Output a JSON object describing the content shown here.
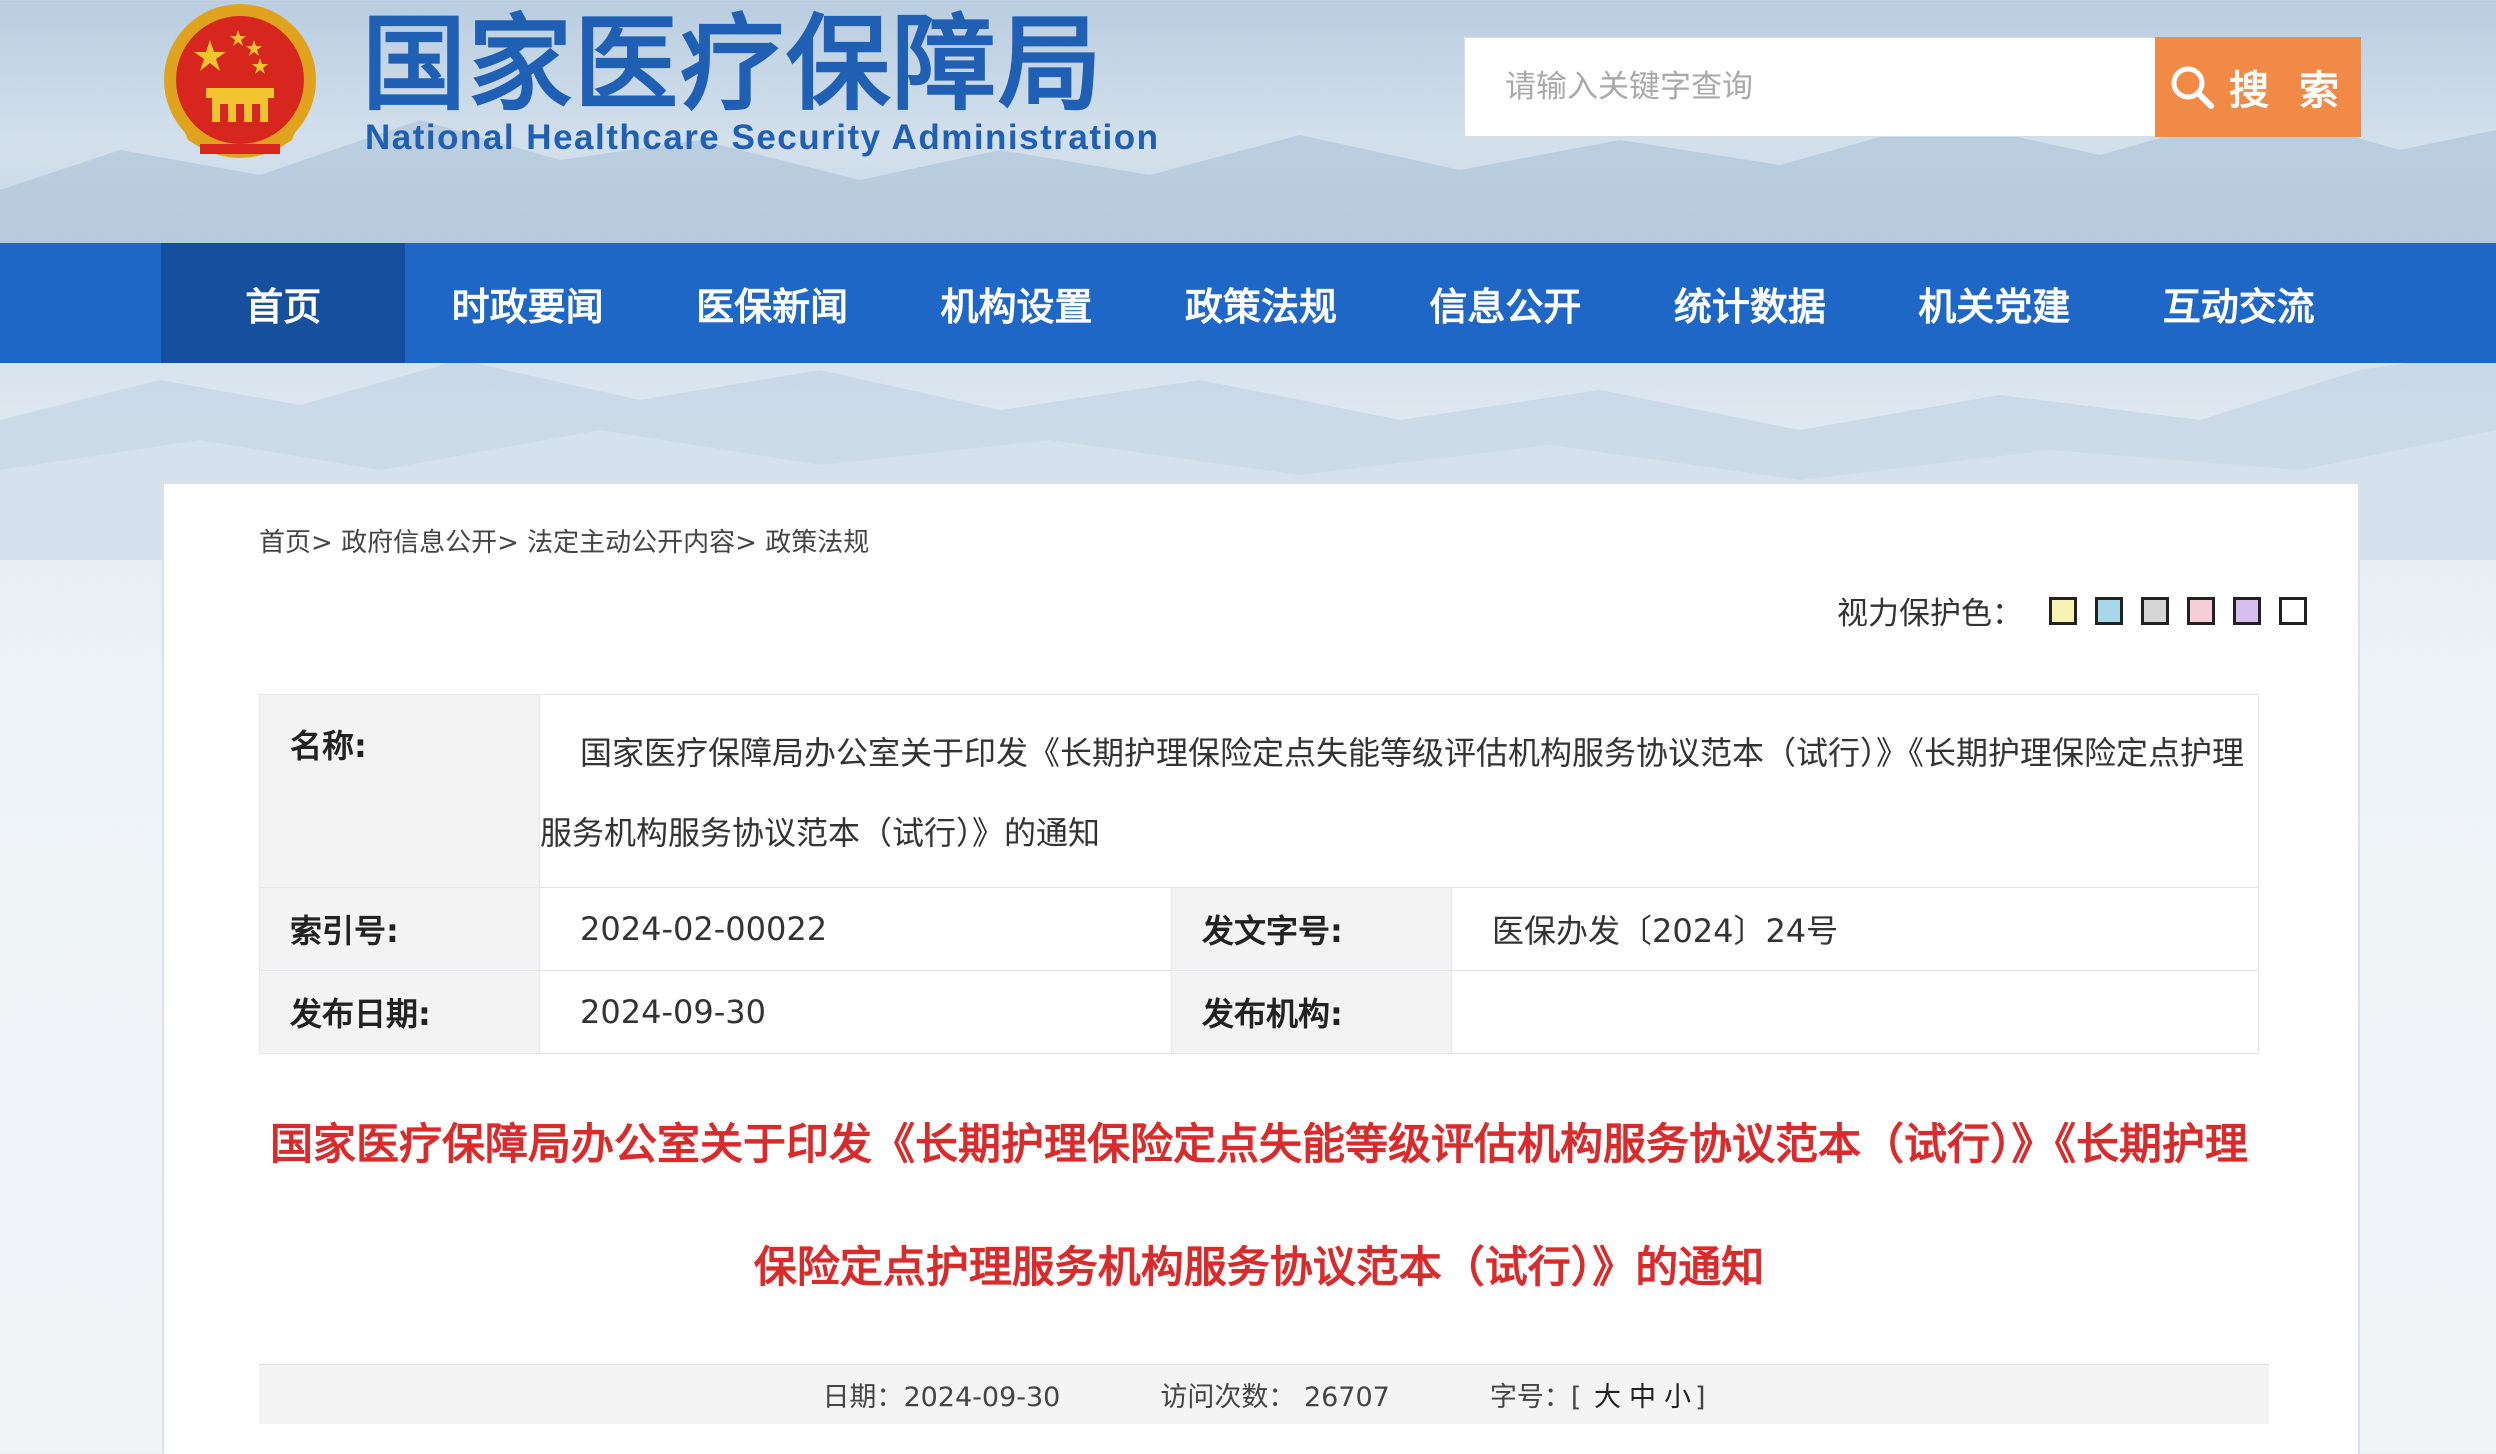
{
  "header": {
    "title": "国家医疗保障局",
    "subtitle": "National Healthcare Security Administration",
    "emblem_icon": "national-emblem-icon"
  },
  "search": {
    "placeholder": "请输入关键字查询",
    "button_label": "搜 索",
    "button_color": "#f08a46"
  },
  "nav": {
    "items": [
      {
        "label": "首页",
        "active": true
      },
      {
        "label": "时政要闻"
      },
      {
        "label": "医保新闻"
      },
      {
        "label": "机构设置"
      },
      {
        "label": "政策法规"
      },
      {
        "label": "信息公开"
      },
      {
        "label": "统计数据"
      },
      {
        "label": "机关党建"
      },
      {
        "label": "互动交流"
      }
    ],
    "bg_color": "#1f67c6",
    "active_color": "#164f9e"
  },
  "breadcrumb": [
    "首页",
    "政府信息公开",
    "法定主动公开内容",
    "政策法规"
  ],
  "eye_protect": {
    "label": "视力保护色：",
    "swatches": [
      "#f6f3b5",
      "#a9d7ea",
      "#d6d6d6",
      "#f6cdd9",
      "#d7bdf0",
      "#ffffff"
    ]
  },
  "info": {
    "name_label": "名称:",
    "name_value": "国家医疗保障局办公室关于印发《长期护理保险定点失能等级评估机构服务协议范本（试行）》《长期护理保险定点护理服务机构服务协议范本（试行）》的通知",
    "index_label": "索引号:",
    "index_value": "2024-02-00022",
    "doc_no_label": "发文字号:",
    "doc_no_value": "医保办发〔2024〕24号",
    "date_label": "发布日期:",
    "date_value": "2024-09-30",
    "org_label": "发布机构:",
    "org_value": ""
  },
  "article": {
    "title": "国家医疗保障局办公室关于印发《长期护理保险定点失能等级评估机构服务协议范本（试行）》《长期护理保险定点护理服务机构服务协议范本（试行）》的通知",
    "title_color": "#d92b2b"
  },
  "meta": {
    "date_label": "日期：",
    "date_value": "2024-09-30",
    "visits_label": "访问次数：",
    "visits_value": "26707",
    "fontsize_label": "字号：",
    "fs_open": "[",
    "fs_large": "大",
    "fs_medium": "中",
    "fs_small": "小",
    "fs_close": "]"
  }
}
